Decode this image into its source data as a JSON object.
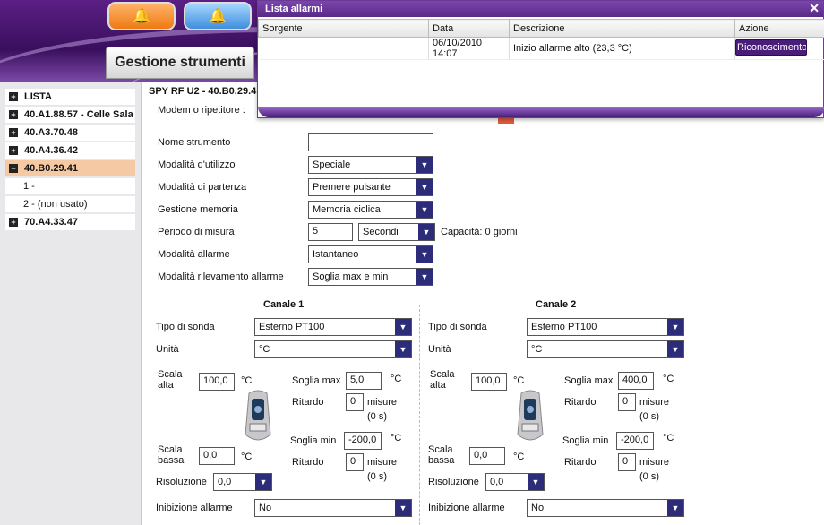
{
  "header": {
    "section_title": "Gestione strumenti",
    "alarm_buttons": [
      {
        "color": "orange",
        "icon": "bell-icon"
      },
      {
        "color": "blue",
        "icon": "bell-icon"
      }
    ]
  },
  "sidebar": {
    "items": [
      {
        "label": "LISTA",
        "expanded": false
      },
      {
        "label": "40.A1.88.57 - Celle Sala",
        "expanded": false
      },
      {
        "label": "40.A3.70.48",
        "expanded": false
      },
      {
        "label": "40.A4.36.42",
        "expanded": false
      },
      {
        "label": "40.B0.29.41",
        "expanded": true,
        "selected": true
      },
      {
        "label": "1 -",
        "sub": true
      },
      {
        "label": "2 - (non usato)",
        "sub": true
      },
      {
        "label": "70.A4.33.47",
        "expanded": false
      }
    ]
  },
  "main": {
    "device_title": "SPY RF U2 - 40.B0.29.4",
    "fields": {
      "modem_label": "Modem o ripetitore :",
      "nome_label": "Nome strumento",
      "nome_value": "",
      "utilizzo_label": "Modalità d'utilizzo",
      "utilizzo_value": "Speciale",
      "partenza_label": "Modalità di partenza",
      "partenza_value": "Premere pulsante",
      "memoria_label": "Gestione memoria",
      "memoria_value": "Memoria ciclica",
      "periodo_label": "Periodo di misura",
      "periodo_value": "5",
      "periodo_unit": "Secondi",
      "capacita": "Capacità: 0 giorni",
      "allarme_label": "Modalità allarme",
      "allarme_value": "Istantaneo",
      "rilevamento_label": "Modalità rilevamento allarme",
      "rilevamento_value": "Soglia max e min"
    },
    "channels": [
      {
        "title": "Canale 1",
        "tipo_label": "Tipo di sonda",
        "tipo_value": "Esterno PT100",
        "unita_label": "Unità",
        "unita_value": "°C",
        "scala_alta_label": "Scala alta",
        "scala_alta_value": "100,0",
        "unit": "°C",
        "scala_bassa_label": "Scala bassa",
        "scala_bassa_value": "0,0",
        "soglia_max_label": "Soglia max",
        "soglia_max_value": "5,0",
        "soglia_min_label": "Soglia min",
        "soglia_min_value": "-200,0",
        "ritardo_label": "Ritardo",
        "ritardo_max_value": "0",
        "ritardo_min_value": "0",
        "misure_label": "misure",
        "secondi_label": "(0 s)",
        "risoluzione_label": "Risoluzione",
        "risoluzione_value": "0,0",
        "inibizione_label": "Inibizione allarme",
        "inibizione_value": "No"
      },
      {
        "title": "Canale 2",
        "tipo_label": "Tipo di sonda",
        "tipo_value": "Esterno PT100",
        "unita_label": "Unità",
        "unita_value": "°C",
        "scala_alta_label": "Scala alta",
        "scala_alta_value": "100,0",
        "unit": "°C",
        "scala_bassa_label": "Scala bassa",
        "scala_bassa_value": "0,0",
        "soglia_max_label": "Soglia max",
        "soglia_max_value": "400,0",
        "soglia_min_label": "Soglia min",
        "soglia_min_value": "-200,0",
        "ritardo_label": "Ritardo",
        "ritardo_max_value": "0",
        "ritardo_min_value": "0",
        "misure_label": "misure",
        "secondi_label": "(0 s)",
        "risoluzione_label": "Risoluzione",
        "risoluzione_value": "0,0",
        "inibizione_label": "Inibizione allarme",
        "inibizione_value": "No"
      }
    ]
  },
  "alarm_popup": {
    "title": "Lista allarmi",
    "columns": [
      "Sorgente",
      "Data",
      "Descrizione",
      "Azione"
    ],
    "rows": [
      {
        "sorgente": "",
        "data": "06/10/2010 14:07",
        "descrizione": "Inizio allarme alto (23,3 °C)",
        "azione": "Riconoscimento"
      }
    ]
  }
}
